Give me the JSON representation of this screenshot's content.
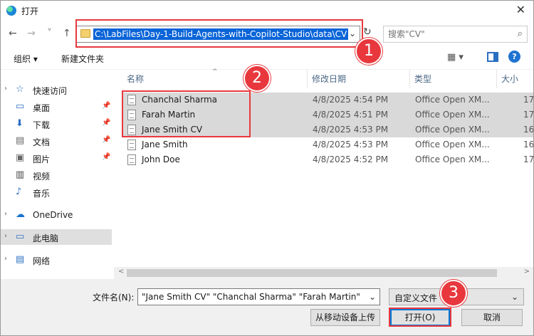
{
  "window": {
    "title": "打开",
    "close_glyph": "✕"
  },
  "nav": {
    "back_glyph": "←",
    "forward_glyph": "→",
    "recent_glyph": "˅",
    "up_glyph": "↑",
    "address_path": "C:\\LabFiles\\Day-1-Build-Agents-with-Copilot-Studio\\data\\CV",
    "address_dropdown_glyph": "⌄",
    "refresh_glyph": "↻",
    "search_placeholder": "搜索\"CV\"",
    "search_glyph": "⌕"
  },
  "toolbar": {
    "organize_label": "组织 ▾",
    "new_folder_label": "新建文件夹",
    "view_glyph": "▦ ▾",
    "help_glyph": "?"
  },
  "sidebar": {
    "items": [
      {
        "label": "快速访问",
        "chevron": "›",
        "icon": "☆",
        "pinned": ""
      },
      {
        "label": "桌面",
        "chevron": "",
        "icon": "▭",
        "pinned": "📌"
      },
      {
        "label": "下载",
        "chevron": "",
        "icon": "⬇",
        "pinned": "📌"
      },
      {
        "label": "文档",
        "chevron": "",
        "icon": "▤",
        "pinned": "📌"
      },
      {
        "label": "图片",
        "chevron": "",
        "icon": "▣",
        "pinned": "📌"
      },
      {
        "label": "视频",
        "chevron": "",
        "icon": "▥",
        "pinned": ""
      },
      {
        "label": "音乐",
        "chevron": "",
        "icon": "♪",
        "pinned": ""
      },
      {
        "label": "OneDrive",
        "chevron": "›",
        "icon": "☁",
        "pinned": ""
      },
      {
        "label": "此电脑",
        "chevron": "›",
        "icon": "▭",
        "pinned": ""
      },
      {
        "label": "网络",
        "chevron": "›",
        "icon": "▤",
        "pinned": ""
      }
    ]
  },
  "columns": {
    "sort_glyph": "^",
    "name": "名称",
    "modified": "修改日期",
    "type": "类型",
    "size": "大小"
  },
  "files": [
    {
      "name": "Chanchal Sharma",
      "modified": "4/8/2025 4:54 PM",
      "type": "Office Open XM...",
      "size": "17"
    },
    {
      "name": "Farah Martin",
      "modified": "4/8/2025 4:51 PM",
      "type": "Office Open XM...",
      "size": "17"
    },
    {
      "name": "Jane Smith CV",
      "modified": "4/8/2025 4:53 PM",
      "type": "Office Open XM...",
      "size": "16"
    },
    {
      "name": "Jane Smith",
      "modified": "4/8/2025 4:53 PM",
      "type": "Office Open XM...",
      "size": "16"
    },
    {
      "name": "John Doe",
      "modified": "4/8/2025 4:52 PM",
      "type": "Office Open XM...",
      "size": "17"
    }
  ],
  "scrollbar": {
    "left_glyph": "<",
    "right_glyph": ">"
  },
  "footer": {
    "filename_label": "文件名(N):",
    "filename_value": "\"Jane Smith CV\" \"Chanchal Sharma\" \"Farah Martin\"",
    "filename_dropdown_glyph": "⌄",
    "filetype_value": "自定义文件",
    "filetype_dropdown_glyph": "⌄",
    "upload_label": "从移动设备上传",
    "open_label": "打开(O)",
    "cancel_label": "取消"
  },
  "annotations": {
    "badge1": "1",
    "badge2": "2",
    "badge3": "3",
    "color": "#e8383d"
  }
}
